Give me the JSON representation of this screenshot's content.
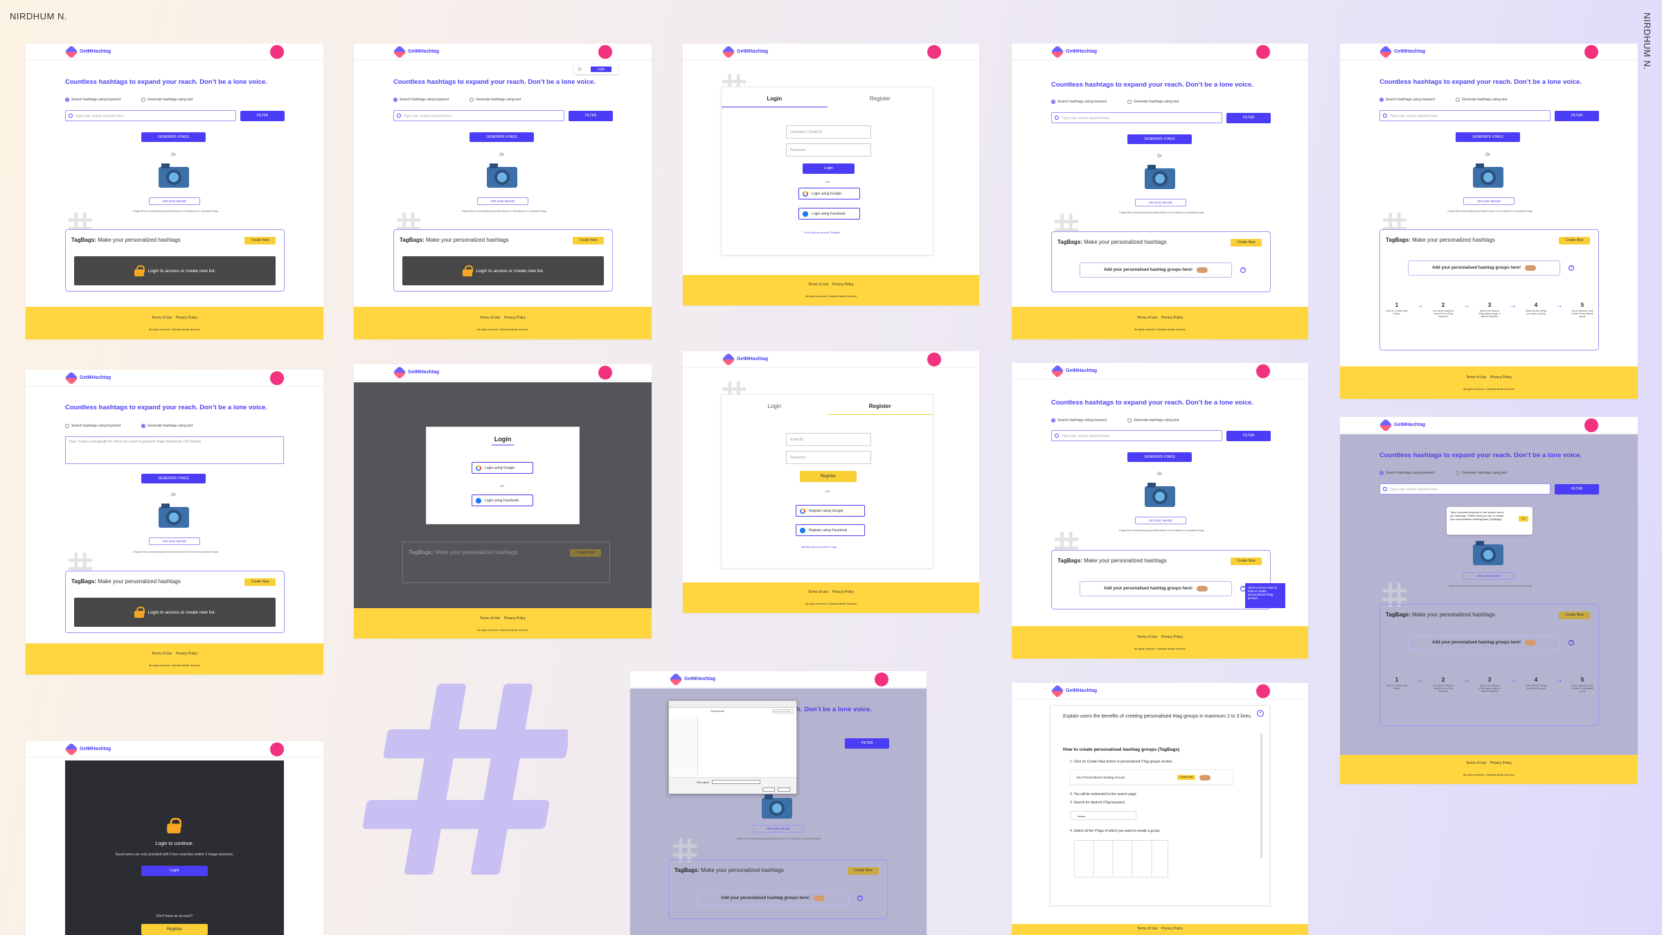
{
  "author": "NIRDHUM N.",
  "app": {
    "name": "GetMHashtag",
    "headline": "Countless hashtags to expand your reach. Don’t be a lone voice."
  },
  "search": {
    "mode_keyword": "Search hashtags using keyword",
    "mode_text": "Generate hashtags using text",
    "placeholder": "Type your search keyword here",
    "filter": "FILTER",
    "generate": "GENERATE #TAGS",
    "or": "Or",
    "upload": "UPLOAD IMAGE",
    "note": "#Tags will be automatically generated based on the features of uploaded image.",
    "textarea_ph": "Type / Paste a paragraph for which you want to generate #tags (Maximum 100 Words)"
  },
  "tagbags": {
    "title_b": "TagBags:",
    "title_r": " Make your personalized hashtags",
    "create": "Create New",
    "locked": "Login to access or create new list.",
    "add": "Add your personalised hashtag groups here!",
    "qm": "?"
  },
  "steps": [
    {
      "n": "1",
      "t": "Click on Create New button"
    },
    {
      "n": "2",
      "t": "You will be asked to search for a #Tag keyword"
    },
    {
      "n": "3",
      "t": "Search for desired #Tag using image or search keyword"
    },
    {
      "n": "4",
      "t": "Select all the #Tags you want to group"
    },
    {
      "n": "5",
      "t": "Once selected, click Create Personalised group"
    }
  ],
  "footer": {
    "terms": "Terms of Use",
    "privacy": "Privacy Policy",
    "rights": "All rights reserved. Celestial Media Services"
  },
  "auth": {
    "login": "Login",
    "register": "Register",
    "user_ph": "Username / Email ID",
    "email_ph": "Email ID",
    "pass_ph": "Password",
    "or": "OR",
    "google_login": "Login using Google",
    "fb_login": "Login using Facebook",
    "google_reg": "Register using Google",
    "fb_reg": "Register using Facebook",
    "no_acc": "Don’t have an account? Register",
    "have_acc": "Already have an account? Login"
  },
  "guest": {
    "continue": "Login to continue.",
    "info": "Guest users are only provided with 5 free searches and/or 2 image searches.",
    "no_acc": "Don’t have an account?"
  },
  "tips": {
    "search_tip": "Type a desired keyword in the search bar to get hashtags. Select what you like to create your personalised hashtag lists (TagBags).",
    "ok": "Ok",
    "group_tip": "Click to know more & how to create personalised #Tag groups."
  },
  "help": {
    "intro": "Explain users the benefits of creating personalised #tag groups in maximum 2 to 3 lines.",
    "how": "How to create personalised hashtag groups (TagBags)",
    "s1": "1. Click on Create New button in personalised #Tag groups section.",
    "group_lbl": "Your Personalised Hashtag Groups",
    "s2": "2. You will be redirected to the search page.",
    "s3": "3. Search for desired #Tag keyword.",
    "s4": "4. Select all the #Tags of which you want to create a group.",
    "kw": "dream"
  },
  "dialog": {
    "path": "Downloads",
    "search": "Search Downloads",
    "name_lbl": "File name:"
  }
}
